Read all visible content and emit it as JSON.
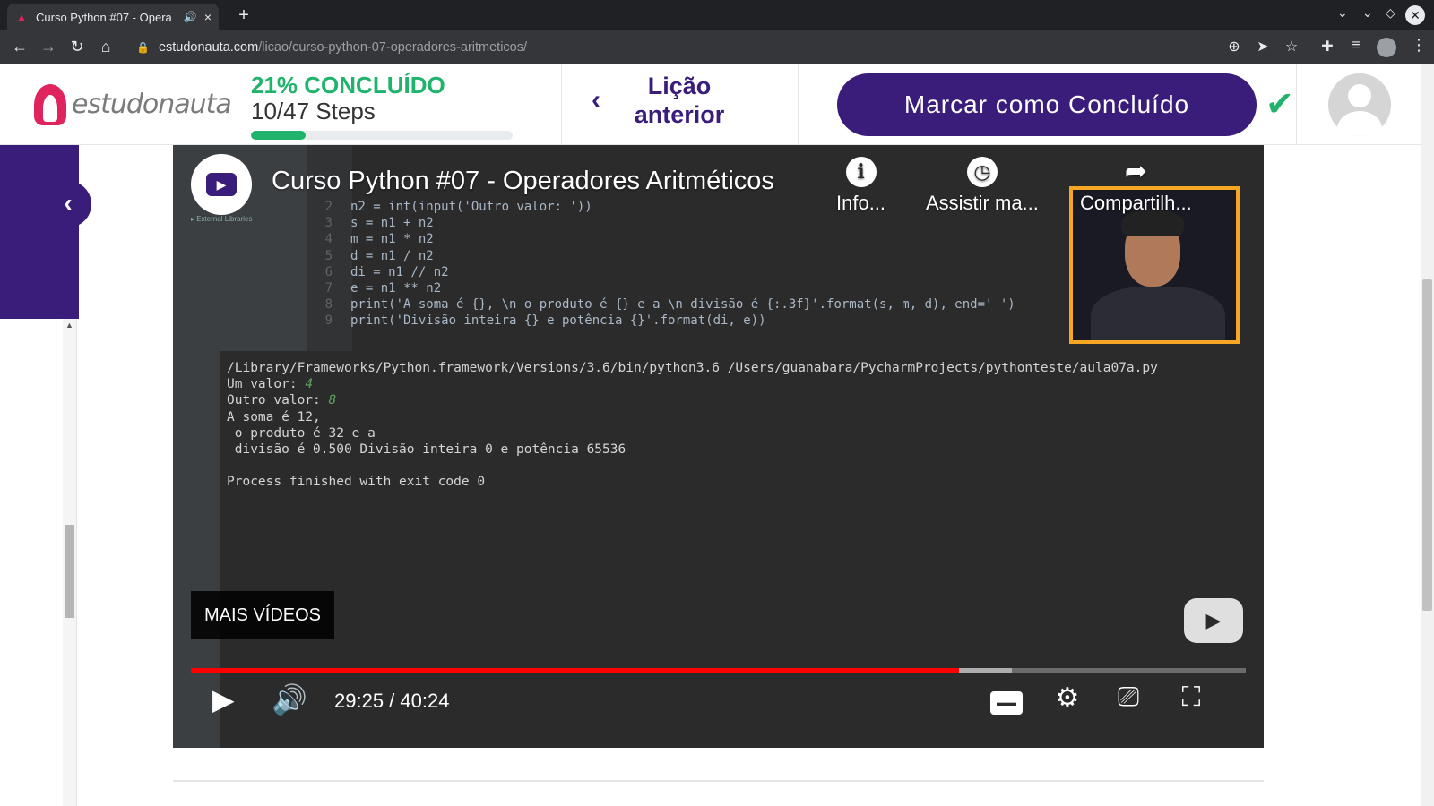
{
  "browser": {
    "tab_title": "Curso Python #07 - Opera",
    "tab_audio_icon": "speaker-icon",
    "tab_close": "×",
    "new_tab": "+",
    "url_domain": "estudonauta.com",
    "url_path": "/licao/curso-python-07-operadores-aritmeticos/"
  },
  "site": {
    "logo_text": "estudonauta",
    "progress_pct_text": "21% CONCLUÍDO",
    "progress_steps": "10/47 Steps",
    "progress_fraction": 0.21,
    "prev_label_line1": "Lição",
    "prev_label_line2": "anterior",
    "mark_complete": "Marcar como Concluído",
    "colors": {
      "brand": "#3a1c7a",
      "accent": "#1fb36b",
      "logo": "#e0245e"
    }
  },
  "video": {
    "title": "Curso Python #07 - Operadores Aritméticos",
    "actions": [
      {
        "label": "Info...",
        "icon": "info-icon"
      },
      {
        "label": "Assistir ma...",
        "icon": "clock-icon"
      },
      {
        "label": "Compartilh...",
        "icon": "share-icon"
      }
    ],
    "more_videos": "MAIS VÍDEOS",
    "time": "29:25 / 40:24",
    "played_fraction": 0.728,
    "buffered_fraction": 0.778,
    "code_lines": [
      {
        "n": "2",
        "text": "n2 = int(input('Outro valor: '))"
      },
      {
        "n": "3",
        "text": "s = n1 + n2"
      },
      {
        "n": "4",
        "text": "m = n1 * n2"
      },
      {
        "n": "5",
        "text": "d = n1 / n2"
      },
      {
        "n": "6",
        "text": "di = n1 // n2"
      },
      {
        "n": "7",
        "text": "e = n1 ** n2"
      },
      {
        "n": "8",
        "text": "print('A soma é {}, \\n o produto é {} e a \\n divisão é {:.3f}'.format(s, m, d), end=' ')"
      },
      {
        "n": "9",
        "text": "print('Divisão inteira {} e potência {}'.format(di, e))"
      }
    ],
    "console_lines": [
      "/Library/Frameworks/Python.framework/Versions/3.6/bin/python3.6 /Users/guanabara/PycharmProjects/pythonteste/aula07a.py",
      "Um valor: ",
      "Outro valor: ",
      "A soma é 12,",
      " o produto é 32 e a",
      " divisão é 0.500 Divisão inteira 0 e potência 65536",
      "",
      "Process finished with exit code 0"
    ],
    "input_values": [
      "4",
      "8"
    ]
  }
}
